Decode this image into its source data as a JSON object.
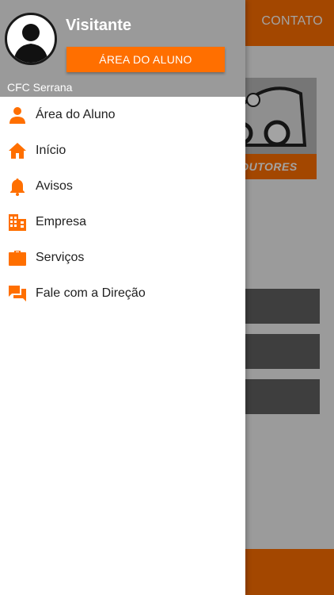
{
  "background": {
    "contact_label": "CONTATO",
    "logo_text": "DUTORES"
  },
  "drawer": {
    "username": "Visitante",
    "area_button_label": "ÁREA DO ALUNO",
    "school_name": "CFC Serrana",
    "items": [
      {
        "label": "Área do Aluno",
        "icon": "person-icon"
      },
      {
        "label": "Início",
        "icon": "home-icon"
      },
      {
        "label": "Avisos",
        "icon": "bell-icon"
      },
      {
        "label": "Empresa",
        "icon": "building-icon"
      },
      {
        "label": "Serviços",
        "icon": "briefcase-icon"
      },
      {
        "label": "Fale com a Direção",
        "icon": "chat-icon"
      }
    ]
  },
  "colors": {
    "accent": "#ff6f00",
    "header_gray": "#9a9a9a"
  }
}
